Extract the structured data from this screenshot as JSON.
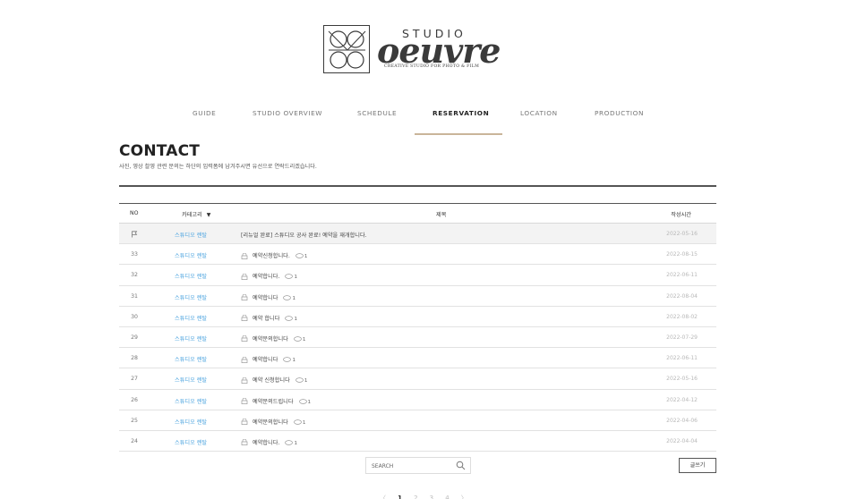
{
  "brand": {
    "studio": "STUDIO",
    "name": "oeuvre",
    "tagline": "CREATIVE STUDIO FOR PHOTO & FILM"
  },
  "nav": {
    "items": [
      {
        "label": "GUIDE"
      },
      {
        "label": "STUDIO OVERVIEW"
      },
      {
        "label": "SCHEDULE"
      },
      {
        "label": "RESERVATION"
      },
      {
        "label": "LOCATION"
      },
      {
        "label": "PRODUCTION"
      }
    ],
    "active": "RESERVATION",
    "accent_color": "#c9b59a"
  },
  "page": {
    "title": "CONTACT",
    "subtitle": "사진, 영상 촬영 관련 문의는 하단의 입력폼에 남겨주시면 유선으로 연락드리겠습니다."
  },
  "table": {
    "headers": {
      "no": "NO",
      "category": "카테고리",
      "title": "제목",
      "date": "작성시간"
    },
    "notice": {
      "category": "스튜디오 렌탈",
      "title": "[리뉴얼 완료] 스튜디오 공사 완료! 예약을 재개합니다.",
      "date": "2022-05-16"
    },
    "rows": [
      {
        "no": "33",
        "category": "스튜디오 렌탈",
        "title": "예약신청합니다.",
        "comments": "1",
        "date": "2022-08-15"
      },
      {
        "no": "32",
        "category": "스튜디오 렌탈",
        "title": "예약합니다.",
        "comments": "1",
        "date": "2022-06-11"
      },
      {
        "no": "31",
        "category": "스튜디오 렌탈",
        "title": "예약합니다",
        "comments": "1",
        "date": "2022-08-04"
      },
      {
        "no": "30",
        "category": "스튜디오 렌탈",
        "title": "예약 합니다",
        "comments": "1",
        "date": "2022-08-02"
      },
      {
        "no": "29",
        "category": "스튜디오 렌탈",
        "title": "예약문의합니다",
        "comments": "1",
        "date": "2022-07-29"
      },
      {
        "no": "28",
        "category": "스튜디오 렌탈",
        "title": "예약합니다",
        "comments": "1",
        "date": "2022-06-11"
      },
      {
        "no": "27",
        "category": "스튜디오 렌탈",
        "title": "예약 신청합니다",
        "comments": "1",
        "date": "2022-05-16"
      },
      {
        "no": "26",
        "category": "스튜디오 렌탈",
        "title": "예약문의드립니다",
        "comments": "1",
        "date": "2022-04-12"
      },
      {
        "no": "25",
        "category": "스튜디오 렌탈",
        "title": "예약문의합니다",
        "comments": "1",
        "date": "2022-04-06"
      },
      {
        "no": "24",
        "category": "스튜디오 렌탈",
        "title": "예약합니다.",
        "comments": "1",
        "date": "2022-04-04"
      }
    ],
    "category_color": "#4aa3df"
  },
  "search": {
    "placeholder": "SEARCH"
  },
  "write_button": "글쓰기",
  "pagination": {
    "prev": "〈",
    "pages": [
      "1",
      "2",
      "3",
      "4"
    ],
    "current": "1",
    "next": "〉"
  }
}
